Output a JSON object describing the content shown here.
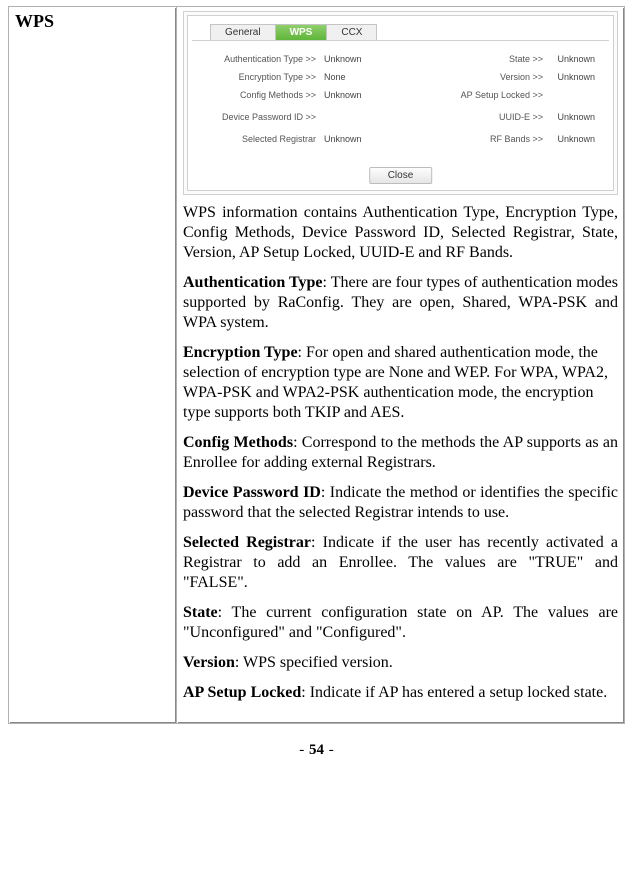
{
  "section_title": "WPS",
  "screenshot": {
    "tabs": {
      "general": "General",
      "wps": "WPS",
      "ccx": "CCX"
    },
    "fields": {
      "auth_type_lbl": "Authentication Type >>",
      "auth_type_val": "Unknown",
      "enc_type_lbl": "Encryption Type >>",
      "enc_type_val": "None",
      "cfg_methods_lbl": "Config Methods >>",
      "cfg_methods_val": "Unknown",
      "dev_pw_lbl": "Device Password ID >>",
      "dev_pw_val": "",
      "sel_reg_lbl": "Selected Registrar",
      "sel_reg_val": "Unknown",
      "state_lbl": "State >>",
      "state_val": "Unknown",
      "version_lbl": "Version >>",
      "version_val": "Unknown",
      "ap_lock_lbl": "AP Setup Locked >>",
      "ap_lock_val": "",
      "uuid_lbl": "UUID-E >>",
      "uuid_val": "Unknown",
      "rf_lbl": "RF Bands >>",
      "rf_val": "Unknown"
    },
    "close": "Close"
  },
  "intro": "WPS information contains Authentication Type, Encryption Type, Config Methods, Device Password ID, Selected Registrar, State, Version, AP Setup Locked, UUID-E and RF Bands.",
  "defs": {
    "auth_b": "Authentication Type",
    "auth_t": ": There are four types of authentication modes supported by RaConfig. They are open, Shared, WPA-PSK and WPA system.",
    "enc_b": "Encryption Type",
    "enc_t": ": For open and shared authentication mode, the selection of encryption type are None and WEP. For WPA, WPA2, WPA-PSK and WPA2-PSK authentication mode, the encryption type supports both TKIP and AES.",
    "cfg_b": "Config Methods",
    "cfg_t": ": Correspond to the methods the AP supports as an Enrollee for adding external Registrars.",
    "dev_b": "Device Password ID",
    "dev_t": ": Indicate the method or identifies the specific password that the selected Registrar intends to use.",
    "sel_b": "Selected Registrar",
    "sel_t": ": Indicate if the user has recently activated a Registrar to add an Enrollee. The values are \"TRUE\" and \"FALSE\".",
    "state_b": "State",
    "state_t": ": The current configuration state on AP. The values are \"Unconfigured\" and \"Configured\".",
    "ver_b": "Version",
    "ver_t": ": WPS specified version.",
    "lock_b": "AP Setup Locked",
    "lock_t": ": Indicate if AP has entered a setup locked state."
  },
  "page_number": "54"
}
